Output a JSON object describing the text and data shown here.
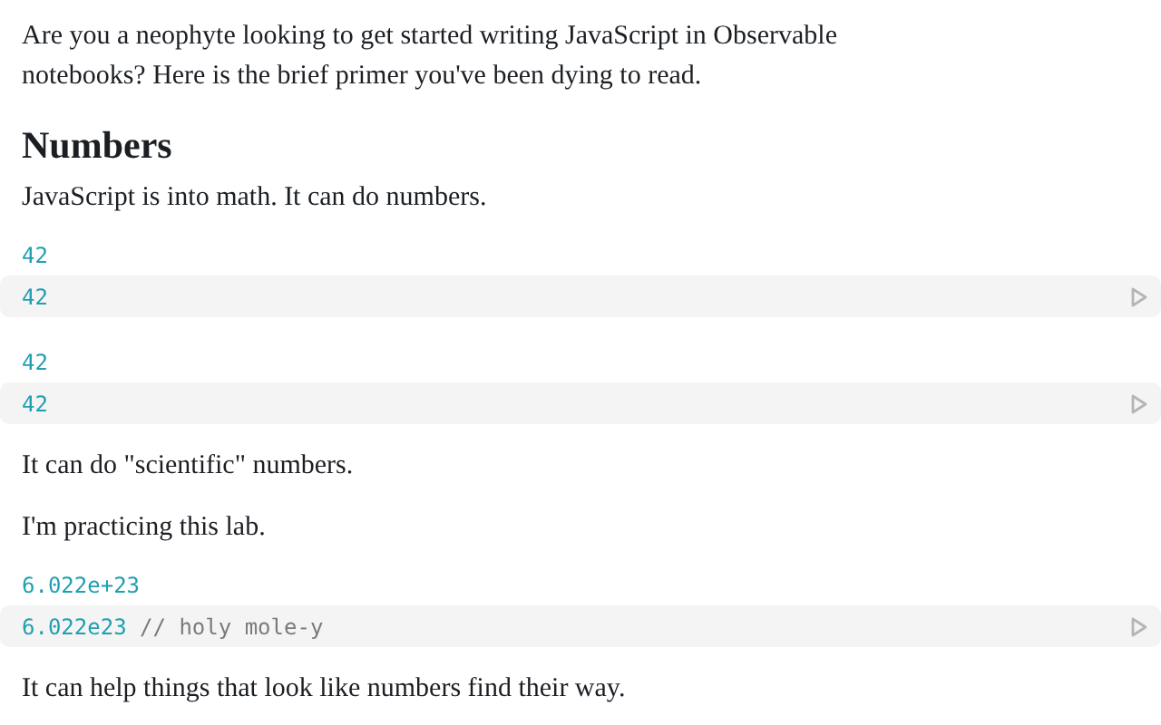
{
  "blocks": [
    {
      "kind": "paragraph",
      "text": "Are you a neophyte looking to get started writing JavaScript in Observable notebooks? Here is the brief primer you've been dying to read."
    },
    {
      "kind": "heading",
      "text": "Numbers"
    },
    {
      "kind": "paragraph",
      "text": "JavaScript is into math. It can do numbers."
    },
    {
      "kind": "cell",
      "output": "42",
      "code": [
        {
          "kind": "number",
          "text": "42"
        }
      ]
    },
    {
      "kind": "cell",
      "output": "42",
      "code": [
        {
          "kind": "number",
          "text": "42"
        }
      ]
    },
    {
      "kind": "paragraph",
      "text": "It can do \"scientific\" numbers."
    },
    {
      "kind": "paragraph",
      "text": "I'm practicing this lab."
    },
    {
      "kind": "cell",
      "output": "6.022e+23",
      "code": [
        {
          "kind": "number",
          "text": "6.022e23"
        },
        {
          "kind": "comment",
          "text": " // holy mole-y"
        }
      ]
    },
    {
      "kind": "paragraph",
      "text": "It can help things that look like numbers find their way."
    }
  ]
}
